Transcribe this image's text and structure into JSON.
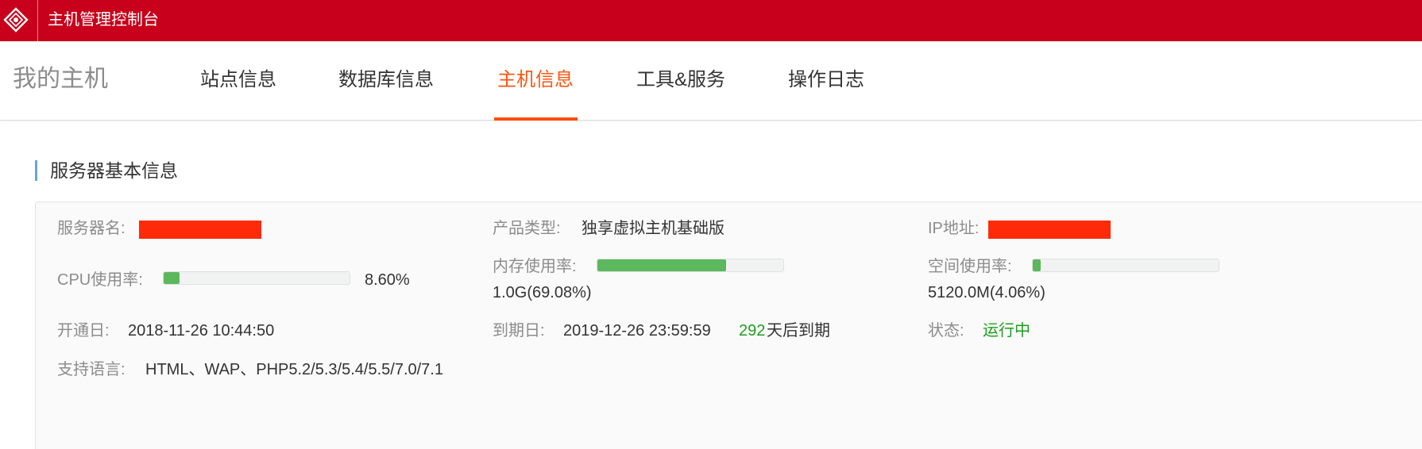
{
  "header": {
    "app_title": "主机管理控制台",
    "logo_icon": "brand-logo-icon",
    "brand_color": "#c8001b"
  },
  "nav": {
    "page_title": "我的主机",
    "tabs": [
      {
        "label": "站点信息",
        "active": false
      },
      {
        "label": "数据库信息",
        "active": false
      },
      {
        "label": "主机信息",
        "active": true
      },
      {
        "label": "工具&服务",
        "active": false
      },
      {
        "label": "操作日志",
        "active": false
      }
    ],
    "active_color": "#ff5511"
  },
  "section": {
    "title": "服务器基本信息"
  },
  "info": {
    "server_name": {
      "label": "服务器名:",
      "value_redacted": true
    },
    "product_type": {
      "label": "产品类型:",
      "value": "独享虚拟主机基础版"
    },
    "ip": {
      "label": "IP地址:",
      "value_redacted": true
    },
    "cpu": {
      "label": "CPU使用率:",
      "value": "8.60%",
      "progress": 0.086
    },
    "memory": {
      "label": "内存使用率:",
      "value": "1.0G(69.08%)",
      "progress": 0.6908
    },
    "disk": {
      "label": "空间使用率:",
      "value": "5120.0M(4.06%)",
      "progress": 0.0406
    },
    "open_date": {
      "label": "开通日:",
      "value": "2018-11-26 10:44:50"
    },
    "expire_date": {
      "label": "到期日:",
      "value": "2019-12-26 23:59:59",
      "days_left": "292",
      "days_suffix": "天后到期"
    },
    "status": {
      "label": "状态:",
      "value": "运行中"
    },
    "languages": {
      "label": "支持语言:",
      "value": "HTML、WAP、PHP5.2/5.3/5.4/5.5/7.0/7.1"
    },
    "progress_color": "#5cb85c",
    "redaction_color": "#ff2a08",
    "status_color": "#1e9e1e"
  }
}
